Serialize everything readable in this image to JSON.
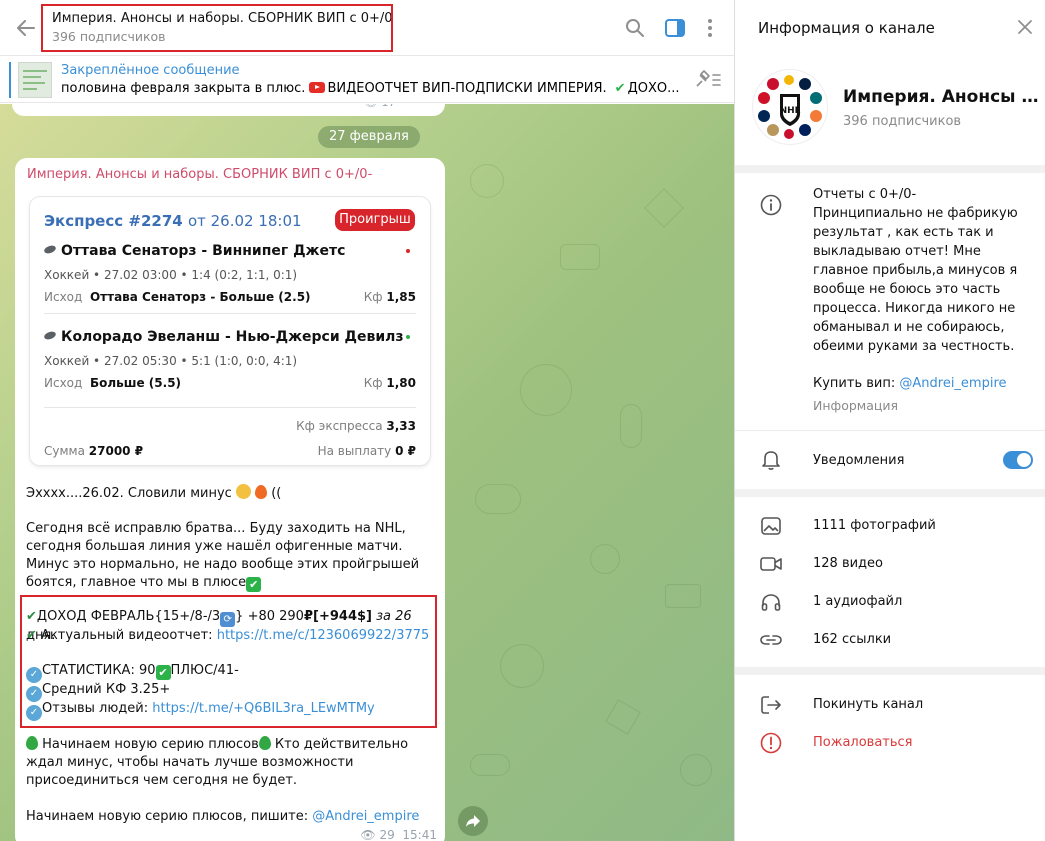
{
  "chat_header": {
    "title": "Империя. Анонсы и наборы. СБОРНИК ВИП с 0+/0-",
    "subtitle": "396 подписчиков"
  },
  "pinned": {
    "title": "Закреплённое сообщение",
    "text_start": "половина февраля закрыта в плюс.",
    "text_video": "ВИДЕООТЧЕТ ВИП-ПОДПИСКИ ИМПЕРИЯ.",
    "text_end": "ДОХО..."
  },
  "previous_message": {
    "views": "17"
  },
  "date_pill": "27 февраля",
  "message": {
    "author": "Империя. Анонсы и наборы. СБОРНИК ВИП с 0+/0-",
    "bet_card": {
      "type": "Экспресс",
      "number": "#2274",
      "date": "от 26.02 18:01",
      "status": "Проигрыш",
      "matches": [
        {
          "teams": "Оттава Сенаторз - Виннипег Джетс",
          "meta": "Хоккей • 27.02 03:00 • 1:4 (0:2, 1:1, 0:1)",
          "bet_label": "Исход",
          "bet_value": "Оттава Сенаторз - Больше (2.5)",
          "kf_label": "Кф",
          "kf_value": "1,85",
          "result_color": "#d8252b"
        },
        {
          "teams": "Колорадо Эвеланш - Нью-Джерси Девилз",
          "meta": "Хоккей • 27.02 05:30 • 5:1 (1:0, 0:0, 4:1)",
          "bet_label": "Исход",
          "bet_value": "Больше (5.5)",
          "kf_label": "Кф",
          "kf_value": "1,80",
          "result_color": "#2bb34a"
        }
      ],
      "express_kf_label": "Кф экспресса",
      "express_kf_value": "3,33",
      "sum_label": "Сумма",
      "sum_value": "27000 ₽",
      "payout_label": "На выплату",
      "payout_value": "0 ₽"
    },
    "p1": "Эххxx....26.02. Словили минус",
    "p1_end": "((",
    "p2": "Сегодня всё исправлю братва... Буду заходить на NHL, сегодня большая линия уже нашёл офигенные матчи. Минус это нормально, не надо вообще этих пройгрышей боятся, главное что мы в плюсе",
    "income_prefix": "ДОХОД ФЕВРАЛЬ{15+/8-/3",
    "income_mid": "} +80 290",
    "income_ruble": "₽",
    "income_usd": "[+944$]",
    "income_days": "за 26",
    "income_suffix": "дня.",
    "video_label": "Актуальный видеоотчет:",
    "video_link": "https://t.me/c/1236069922/3775",
    "stat_a": "СТАТИСТИКА: 90",
    "stat_b": "ПЛЮС/41-",
    "avg_kf": "Средний КФ 3.25+",
    "reviews_label": "Отзывы людей:",
    "reviews_link": "https://t.me/+Q6BIL3ra_LEwMTMy",
    "p4_a": "Начинаем новую серию плюсов",
    "p4_b": "Кто действительно ждал минус, чтобы начать лучше возможности присоединиться чем сегодня не будет.",
    "p5": "Начинаем новую серию плюсов, пишите:",
    "p5_link": "@Andrei_empire",
    "views": "29",
    "time": "15:41"
  },
  "panel": {
    "header": "Информация о канале",
    "channel_name": "Империя. Анонсы и наборы. СБОРНИК ВИП с 0+/0-",
    "subscribers": "396 подписчиков",
    "description": "Отчеты с 0+/0-\nПринципиально не фабрикую результат , как есть так и выкладываю отчет! Мне главное прибыль,а минусов я вообще не боюсь это часть процесса. Никогда никого не обманывал и не собираюсь, обеими руками за честность.",
    "buy_label": "Купить вип:",
    "buy_link": "@Andrei_empire",
    "info_label": "Информация",
    "notifications_label": "Уведомления",
    "notifications_on": true,
    "media": [
      {
        "icon": "photo-icon",
        "label": "1111 фотографий"
      },
      {
        "icon": "video-icon",
        "label": "128 видео"
      },
      {
        "icon": "headphones-icon",
        "label": "1 аудиофайл"
      },
      {
        "icon": "link-icon",
        "label": "162 ссылки"
      }
    ],
    "leave_label": "Покинуть канал",
    "report_label": "Пожаловаться"
  },
  "colors": {
    "accent": "#3a8fd6",
    "author": "#cf4b6a",
    "lost": "#d8252b",
    "highlight_box": "#d8252b",
    "danger": "#d83a3a"
  }
}
